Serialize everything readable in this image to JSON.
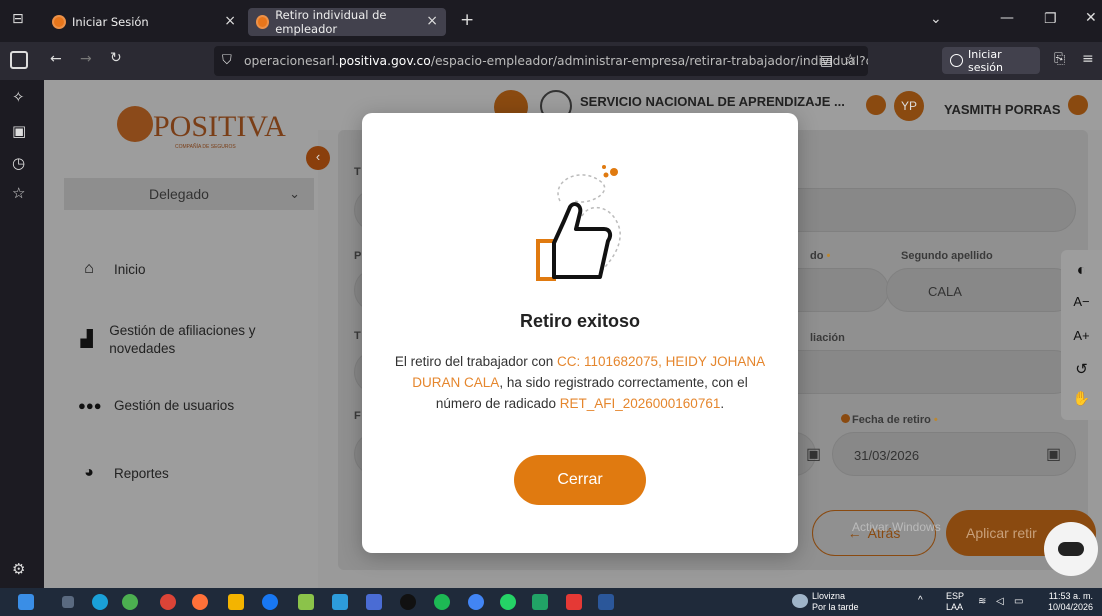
{
  "browser": {
    "tabs": [
      {
        "title": "Iniciar Sesión"
      },
      {
        "title": "Retiro individual de empleador"
      }
    ],
    "url_prefix": "operacionesarl.",
    "url_domain": "positiva.gov.co",
    "url_path": "/espacio-empleador/administrar-empresa/retirar-trabajador/individual?docu",
    "signin_label": "Iniciar sesión"
  },
  "header": {
    "entity": "SERVICIO NACIONAL DE APRENDIZAJE ...",
    "user_initials": "YP",
    "user_name": "YASMITH PORRAS"
  },
  "sidebar": {
    "logo_word": "POSITIVA",
    "logo_sub": "COMPAÑÍA DE SEGUROS",
    "role": "Delegado",
    "items": [
      {
        "label": "Inicio",
        "icon": "home-icon"
      },
      {
        "label": "Gestión de afiliaciones y novedades",
        "icon": "building-icon"
      },
      {
        "label": "Gestión de usuarios",
        "icon": "users-icon"
      },
      {
        "label": "Reportes",
        "icon": "pie-chart-icon"
      }
    ]
  },
  "form": {
    "second_surname_label": "Segundo apellido",
    "second_surname_value": "CALA",
    "first_surname_label_fragment": "do",
    "affiliation_label_fragment": "liación",
    "retire_date_label": "Fecha de retiro",
    "retire_date_value": "31/03/2026",
    "back_label": "Atrás",
    "apply_label": "Aplicar retir",
    "left_fragments": [
      "T",
      "P",
      "T",
      "F"
    ]
  },
  "accessibility": [
    "◐",
    "A−",
    "A+",
    "↺",
    "✋"
  ],
  "watermark": "Activar Windows",
  "modal": {
    "title": "Retiro exitoso",
    "msg_pre": "El retiro del trabajador con ",
    "msg_worker": "CC: 1101682075, HEIDY JOHANA DURAN CALA",
    "msg_mid": ", ha sido registrado correctamente, con el número de radicado ",
    "msg_radicado": "RET_AFI_2026000160761",
    "msg_end": ".",
    "close_label": "Cerrar"
  },
  "taskbar": {
    "weather_title": "Llovizna",
    "weather_sub": "Por la tarde",
    "lang": "ESP",
    "lang_sub": "LAA",
    "time": "11:53 a. m.",
    "date": "10/04/2026"
  },
  "colors": {
    "accent": "#e07a10",
    "highlight": "#e5862d"
  }
}
